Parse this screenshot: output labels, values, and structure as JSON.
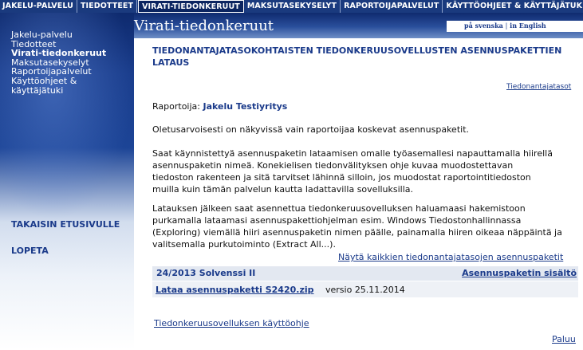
{
  "topnav": {
    "tabs": [
      {
        "label": "JAKELU-PALVELU"
      },
      {
        "label": "TIEDOTTEET"
      },
      {
        "label": "VIRATI-TIEDONKERUUT",
        "active": true
      },
      {
        "label": "MAKSUTASEKYSELYT"
      },
      {
        "label": "RAPORTOIJAPALVELUT"
      },
      {
        "label": "KÄYTTÖOHJEET & KÄYTTÄJÄTUKI"
      }
    ]
  },
  "header": {
    "title": "Virati-tiedonkeruut",
    "lang_sv": "på svenska",
    "lang_sep": "|",
    "lang_en": "in English"
  },
  "sidebar": {
    "items": [
      {
        "label": "Jakelu-palvelu"
      },
      {
        "label": "Tiedotteet"
      },
      {
        "label": "Virati-tiedonkeruut",
        "active": true
      },
      {
        "label": "Maksutasekyselyt"
      },
      {
        "label": "Raportoijapalvelut"
      },
      {
        "label": "Käyttöohjeet &"
      },
      {
        "label": "käyttäjätuki"
      }
    ],
    "back_to_front": "TAKAISIN ETUSIVULLE",
    "logout": "LOPETA"
  },
  "main": {
    "title_line1": "TIEDONANTAJATASOKOHTAISTEN TIEDONKERUUSOVELLUSTEN ASENNUSPAKETTIEN",
    "title_line2": "LATAUS",
    "level_link": "Tiedonantajatasot",
    "reporter_label": "Raportoija:",
    "reporter_name": "Jakelu Testiyritys",
    "para1": "Oletusarvoisesti on näkyvissä vain raportoijaa koskevat asennuspaketit.",
    "para2_lines": [
      "Saat käynnistettyä asennuspaketin lataamisen omalle työasemallesi napauttamalla hiirellä",
      "asennuspaketin nimeä. Konekielisen tiedonvälityksen ohje kuvaa muodostettavan",
      "tiedoston rakenteen ja sitä tarvitset lähinnä silloin, jos muodostat raportointitiedoston",
      "muilla kuin tämän palvelun kautta ladattavilla sovelluksilla."
    ],
    "para3_lines": [
      "Latauksen jälkeen saat asennettua tiedonkeruusovelluksen haluamaasi hakemistoon",
      "purkamalla lataamasi asennuspakettiohjelman esim. Windows Tiedostonhallinnassa",
      "(Exploring) viemällä hiiri asennuspaketin nimen päälle, painamalla hiiren oikeaa näppäintä ja",
      "valitsemalla purkutoiminto (Extract All...)."
    ],
    "show_all_link": "Näytä kaikkien tiedonantajatasojen asennuspaketit",
    "package": {
      "name": "24/2013 Solvenssi II",
      "contents_link": "Asennuspaketin sisältö",
      "download_link": "Lataa asennuspaketti S2420.zip",
      "version": "versio 25.11.2014"
    },
    "guide_link": "Tiedonkeruusovelluksen käyttöohje",
    "back_link": "Paluu"
  },
  "colors": {
    "nav_bg": "#1a3a7e",
    "link": "#1a3a8a",
    "row_bg": "#e3e8f1"
  }
}
